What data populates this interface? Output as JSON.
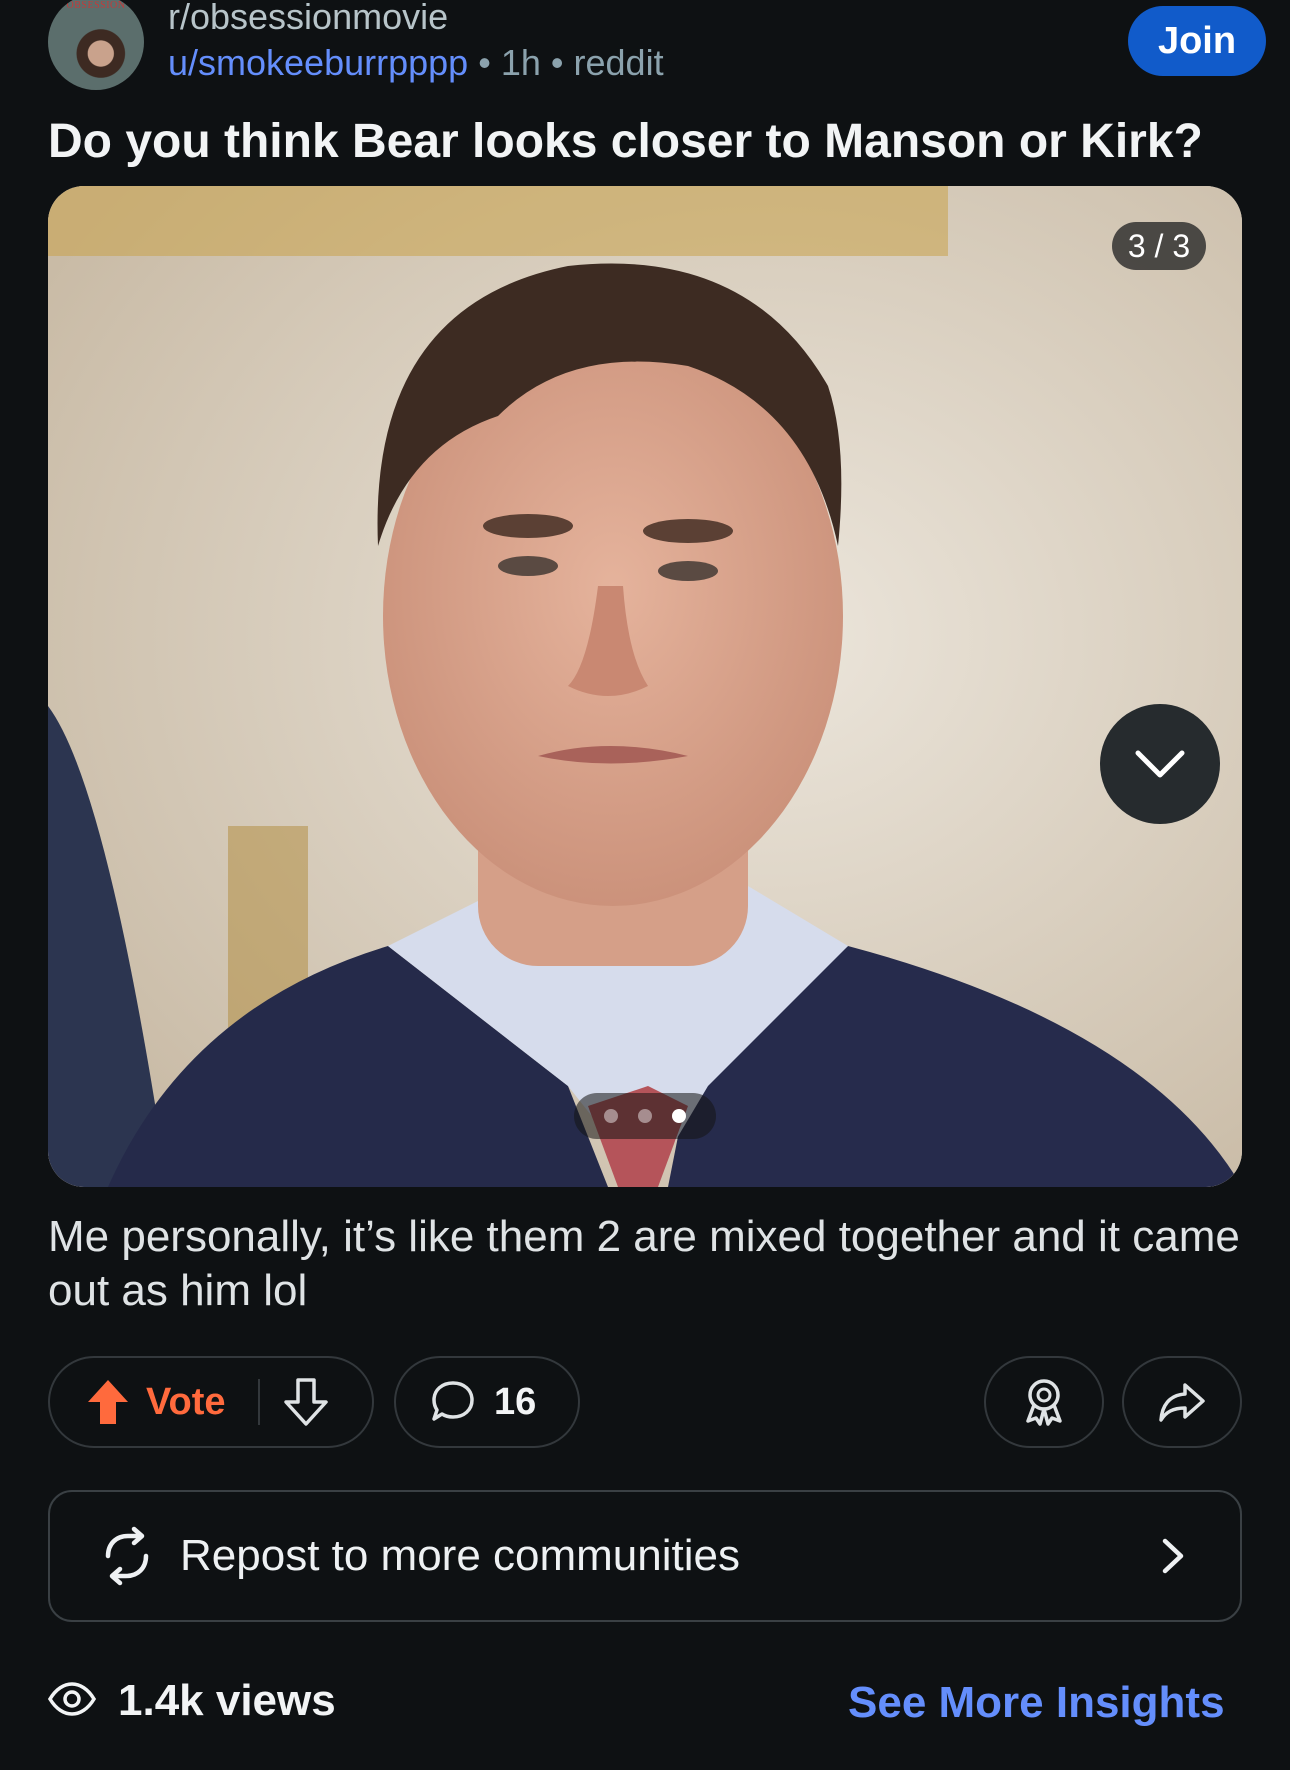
{
  "header": {
    "subreddit": "r/obsessionmovie",
    "author": "u/smokeeburrpppp",
    "separator": "•",
    "time": "1h",
    "source": "reddit",
    "join_label": "Join",
    "avatar_text": "OBSESSION"
  },
  "post": {
    "title": "Do you think Bear looks closer to Manson or Kirk?",
    "image_counter": "3 / 3",
    "gallery": {
      "current": 3,
      "total": 3
    },
    "body": "Me personally, it’s like them 2 are mixed together and it came out as him lol"
  },
  "actions": {
    "vote_label": "Vote",
    "comment_count": "16"
  },
  "repost": {
    "label": "Repost to more communities"
  },
  "footer": {
    "views": "1.4k views",
    "insights_label": "See More Insights"
  },
  "icons": {
    "upvote": "arrow-up-icon",
    "downvote": "arrow-down-icon",
    "comment": "speech-bubble-icon",
    "award": "award-icon",
    "share": "share-arrow-icon",
    "repost": "repost-cycle-icon",
    "chevron_right": "chevron-right-icon",
    "chevron_down": "chevron-down-icon",
    "views": "eye-icon"
  },
  "colors": {
    "background": "#0e1113",
    "link_blue": "#648efc",
    "join_button": "#115bca",
    "upvote_orange": "#ff6a3d"
  }
}
